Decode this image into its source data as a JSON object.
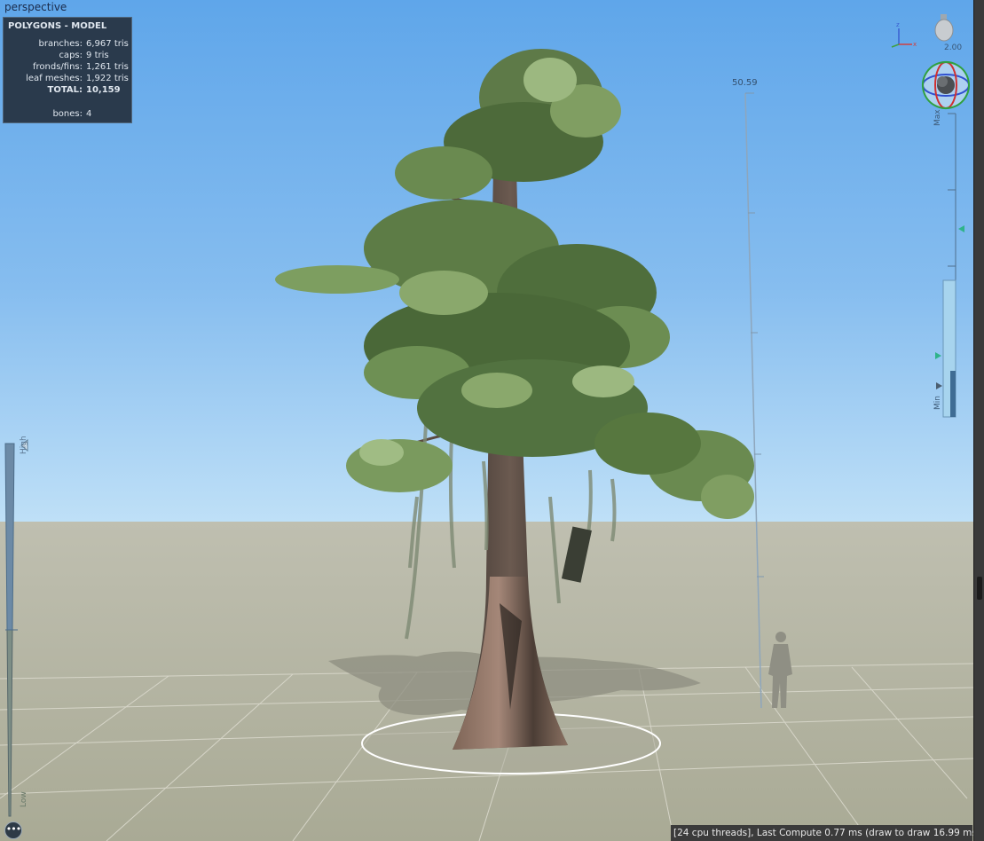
{
  "viewport": {
    "camera_label": "perspective"
  },
  "stats": {
    "title": "POLYGONS - MODEL",
    "rows": [
      {
        "label": "branches:",
        "value": "6,967",
        "unit": "tris"
      },
      {
        "label": "caps:",
        "value": "9",
        "unit": "tris"
      },
      {
        "label": "fronds/fins:",
        "value": "1,261",
        "unit": "tris"
      },
      {
        "label": "leaf meshes:",
        "value": "1,922",
        "unit": "tris"
      },
      {
        "label": "TOTAL:",
        "value": "10,159",
        "unit": ""
      }
    ],
    "bones_label": "bones:",
    "bones_value": "4"
  },
  "height_ruler": {
    "readout": "50.59"
  },
  "light": {
    "intensity_label": "2.00",
    "icon": "light-bulb-icon"
  },
  "lod_slider": {
    "max_label": "Max",
    "min_label": "Min"
  },
  "side_slider": {
    "high_label": "High",
    "low_label": "Low"
  },
  "status_bar": {
    "text": "[24 cpu threads], Last Compute 0.77 ms (draw to draw 16.99 ms)"
  },
  "menu_button": {
    "icon": "more-icon",
    "glyph": "•••"
  },
  "colors": {
    "sky_top": "#5fa6ea",
    "sky_bottom": "#b9dcf6",
    "ground": "#b3b29f",
    "stats_bg": "#2a3a4c",
    "status_bg": "#3b3b3b"
  }
}
